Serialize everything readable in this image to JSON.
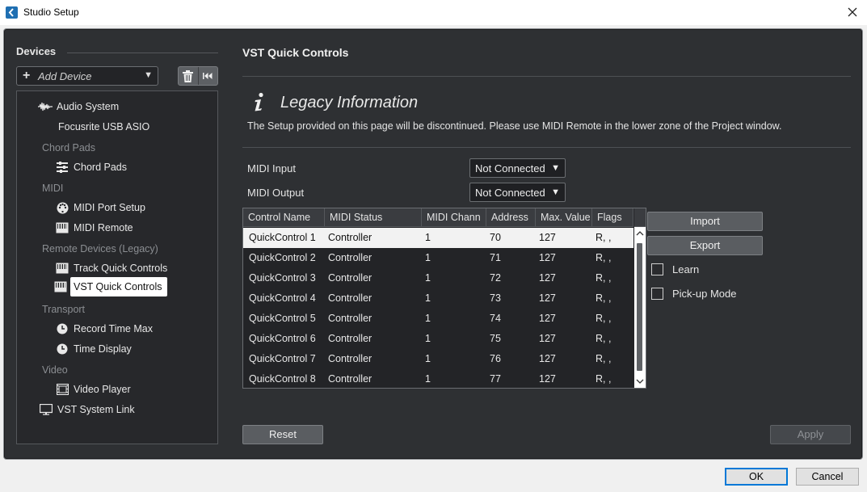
{
  "window": {
    "title": "Studio Setup"
  },
  "devices": {
    "header": "Devices",
    "add_device_label": "Add Device",
    "tree": [
      {
        "type": "item",
        "label": "Audio System",
        "icon": "waveform-icon",
        "indent": 1
      },
      {
        "type": "item",
        "label": "Focusrite USB ASIO",
        "icon": "",
        "indent": 2
      },
      {
        "type": "category",
        "label": "Chord Pads"
      },
      {
        "type": "item",
        "label": "Chord Pads",
        "icon": "chord-pads-icon",
        "indent": 2
      },
      {
        "type": "category",
        "label": "MIDI"
      },
      {
        "type": "item",
        "label": "MIDI Port Setup",
        "icon": "midi-port-icon",
        "indent": 2
      },
      {
        "type": "item",
        "label": "MIDI Remote",
        "icon": "keyboard-icon",
        "indent": 2
      },
      {
        "type": "category",
        "label": "Remote Devices (Legacy)"
      },
      {
        "type": "item",
        "label": "Track Quick Controls",
        "icon": "keyboard-icon",
        "indent": 2
      },
      {
        "type": "item",
        "label": "VST Quick Controls",
        "icon": "keyboard-icon",
        "indent": 2,
        "selected": true
      },
      {
        "type": "category",
        "label": "Transport"
      },
      {
        "type": "item",
        "label": "Record Time Max",
        "icon": "clock-icon",
        "indent": 2
      },
      {
        "type": "item",
        "label": "Time Display",
        "icon": "clock-icon",
        "indent": 2
      },
      {
        "type": "category",
        "label": "Video"
      },
      {
        "type": "item",
        "label": "Video Player",
        "icon": "film-icon",
        "indent": 2
      },
      {
        "type": "item",
        "label": "VST System Link",
        "icon": "monitor-icon",
        "indent": 0
      }
    ]
  },
  "panel": {
    "title": "VST Quick Controls",
    "legacy_title": "Legacy Information",
    "legacy_text": "The Setup provided on this page will be discontinued. Please use MIDI Remote in the lower zone of the Project window.",
    "midi_input_label": "MIDI Input",
    "midi_input_value": "Not Connected",
    "midi_output_label": "MIDI Output",
    "midi_output_value": "Not Connected",
    "table": {
      "columns": [
        "Control Name",
        "MIDI Status",
        "MIDI Chann",
        "Address",
        "Max. Value",
        "Flags"
      ],
      "rows": [
        [
          "QuickControl 1",
          "Controller",
          "1",
          "70",
          "127",
          "R, ,"
        ],
        [
          "QuickControl 2",
          "Controller",
          "1",
          "71",
          "127",
          "R, ,"
        ],
        [
          "QuickControl 3",
          "Controller",
          "1",
          "72",
          "127",
          "R, ,"
        ],
        [
          "QuickControl 4",
          "Controller",
          "1",
          "73",
          "127",
          "R, ,"
        ],
        [
          "QuickControl 5",
          "Controller",
          "1",
          "74",
          "127",
          "R, ,"
        ],
        [
          "QuickControl 6",
          "Controller",
          "1",
          "75",
          "127",
          "R, ,"
        ],
        [
          "QuickControl 7",
          "Controller",
          "1",
          "76",
          "127",
          "R, ,"
        ],
        [
          "QuickControl 8",
          "Controller",
          "1",
          "77",
          "127",
          "R, ,"
        ]
      ],
      "selected_row": 0
    },
    "import_label": "Import",
    "export_label": "Export",
    "learn_label": "Learn",
    "pickup_label": "Pick-up Mode",
    "reset_label": "Reset",
    "apply_label": "Apply"
  },
  "footer": {
    "ok_label": "OK",
    "cancel_label": "Cancel"
  }
}
